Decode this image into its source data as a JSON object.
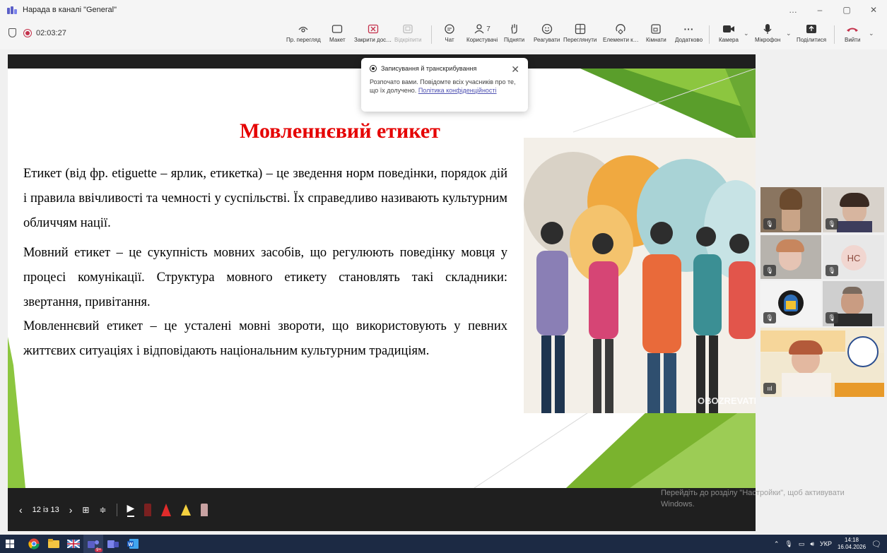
{
  "window": {
    "title": "Нарада в каналі \"General\"",
    "controls": [
      "…",
      "–",
      "▢",
      "✕"
    ]
  },
  "toolbar": {
    "timer": "02:03:27",
    "buttons": [
      {
        "label": "Пр. перегляд",
        "icon": "eye-icon"
      },
      {
        "label": "Макет",
        "icon": "layout-icon"
      },
      {
        "label": "Закрити дос…",
        "icon": "stop-share-icon"
      },
      {
        "label": "Відкріпити",
        "icon": "unpin-icon"
      },
      {
        "label": "Чат",
        "icon": "chat-icon"
      },
      {
        "label": "Користувачі",
        "icon": "people-icon",
        "count": "7"
      },
      {
        "label": "Підняти",
        "icon": "raise-hand-icon"
      },
      {
        "label": "Реагувати",
        "icon": "smile-icon"
      },
      {
        "label": "Переглянути",
        "icon": "view-icon"
      },
      {
        "label": "Елементи к…",
        "icon": "apps-icon"
      },
      {
        "label": "Кімнати",
        "icon": "rooms-icon"
      },
      {
        "label": "Додатково",
        "icon": "more-icon"
      },
      {
        "label": "Камера",
        "icon": "camera-icon"
      },
      {
        "label": "Мікрофон",
        "icon": "microphone-icon"
      },
      {
        "label": "Поділитися",
        "icon": "share-icon"
      },
      {
        "label": "Вийти",
        "icon": "leave-icon"
      }
    ]
  },
  "popup": {
    "title": "Записування й транскрибування",
    "body": "Розпочато вами. Повідомте всіх учасників про те, що їх долучено.",
    "link": "Політика конфіденційності"
  },
  "slide": {
    "title": "Мовленнєвий етикет",
    "paragraph1": "Етикет (від фр. etiguette – ярлик, етикетка) – це зведення норм поведінки, порядок дій і правила ввічливості та чемності у суспільстві. Їх справедливо називають культурним обличчям нації.",
    "paragraph2": "Мовний етикет – це сукупність мовних засобів, що регулюють поведінку мовця у процесі комунікації. Структура мовного етикету становлять такі складники: звертання, привітання.",
    "paragraph3": "Мовленнєвий етикет – це усталені мовні звороти, що використовують у певних життєвих ситуаціях і відповідають національним культурним традиціям.",
    "image_watermark": "OBOZREVATEL"
  },
  "slide_controls": {
    "page": "12 із 13"
  },
  "participants": {
    "initials": "НС"
  },
  "activation": {
    "line1": "Перейдіть до розділу \"Настройки\", щоб активувати",
    "line2": "Windows."
  },
  "taskbar": {
    "language": "УКР",
    "time": "14:18",
    "date": "16.04.2026",
    "badge": "9+"
  },
  "colors": {
    "slide_title": "#e50000",
    "accent_green": "#7ab32e",
    "teams_purple": "#5b5fc7",
    "leave_red": "#c4314b"
  }
}
